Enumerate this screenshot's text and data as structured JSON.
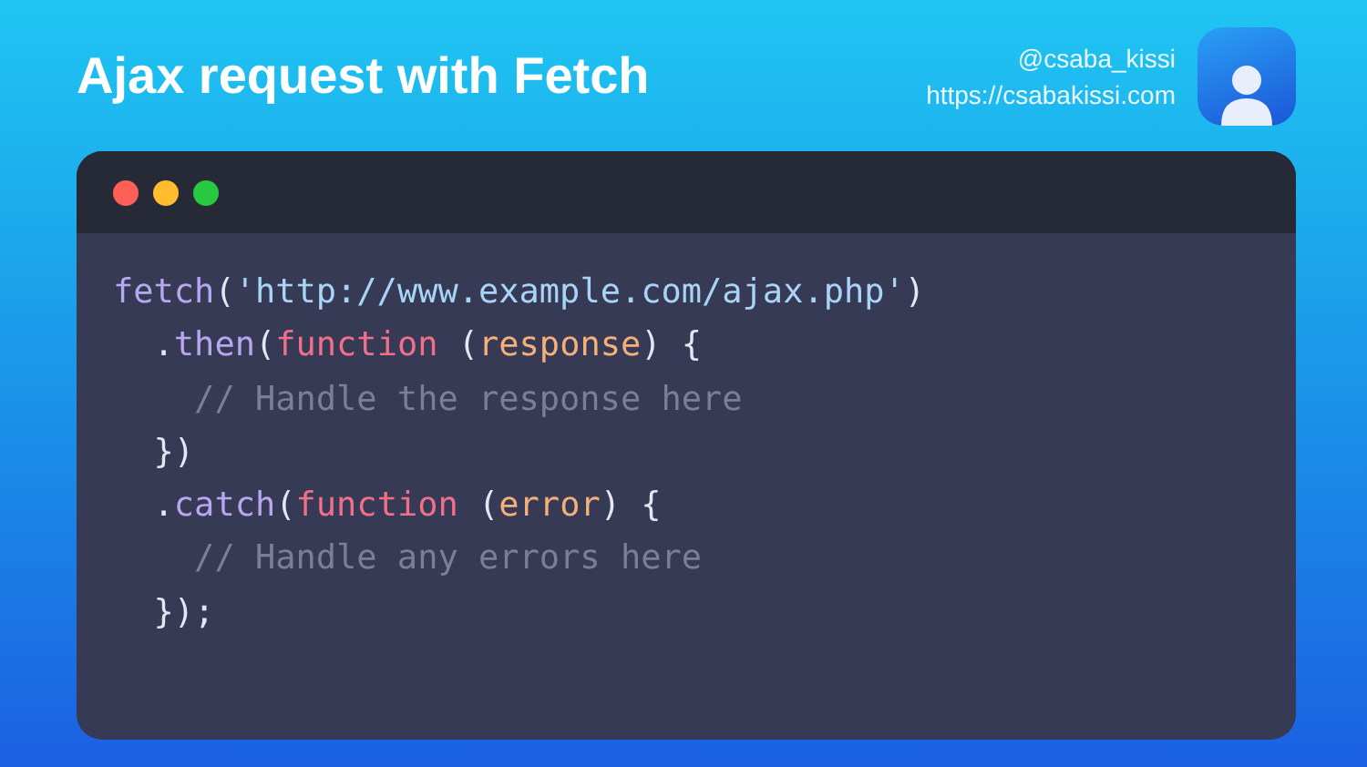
{
  "title": "Ajax request with Fetch",
  "author": {
    "handle": "@csaba_kissi",
    "url": "https://csabakissi.com"
  },
  "code_window": {
    "lines": [
      {
        "tokens": [
          {
            "kind": "call",
            "text": "fetch"
          },
          {
            "kind": "punct",
            "text": "("
          },
          {
            "kind": "string",
            "text": "'http://www.example.com/ajax.php'"
          },
          {
            "kind": "punct",
            "text": ")"
          }
        ]
      },
      {
        "tokens": [
          {
            "kind": "punct",
            "text": "  ."
          },
          {
            "kind": "call",
            "text": "then"
          },
          {
            "kind": "punct",
            "text": "("
          },
          {
            "kind": "keyword",
            "text": "function"
          },
          {
            "kind": "punct",
            "text": " ("
          },
          {
            "kind": "param",
            "text": "response"
          },
          {
            "kind": "punct",
            "text": ") {"
          }
        ]
      },
      {
        "tokens": [
          {
            "kind": "comment",
            "text": "    // Handle the response here"
          }
        ]
      },
      {
        "tokens": [
          {
            "kind": "punct",
            "text": "  })"
          }
        ]
      },
      {
        "tokens": [
          {
            "kind": "punct",
            "text": "  ."
          },
          {
            "kind": "call",
            "text": "catch"
          },
          {
            "kind": "punct",
            "text": "("
          },
          {
            "kind": "keyword",
            "text": "function"
          },
          {
            "kind": "punct",
            "text": " ("
          },
          {
            "kind": "param",
            "text": "error"
          },
          {
            "kind": "punct",
            "text": ") {"
          }
        ]
      },
      {
        "tokens": [
          {
            "kind": "comment",
            "text": "    // Handle any errors here"
          }
        ]
      },
      {
        "tokens": [
          {
            "kind": "punct",
            "text": "  });"
          }
        ]
      }
    ]
  }
}
